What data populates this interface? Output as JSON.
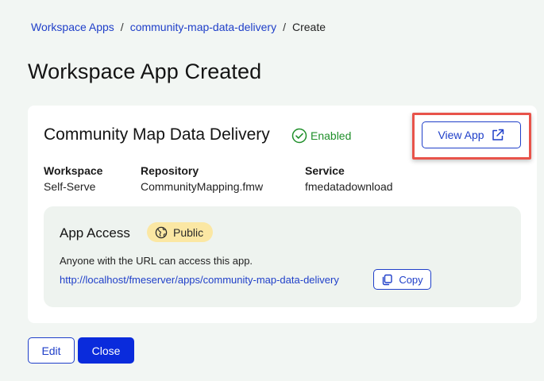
{
  "breadcrumb": {
    "items": [
      "Workspace Apps",
      "community-map-data-delivery",
      "Create"
    ],
    "separator": "/"
  },
  "page_title": "Workspace App Created",
  "app": {
    "name": "Community Map Data Delivery",
    "status": "Enabled",
    "view_label": "View App",
    "meta": [
      {
        "label": "Workspace",
        "value": "Self-Serve"
      },
      {
        "label": "Repository",
        "value": "CommunityMapping.fmw"
      },
      {
        "label": "Service",
        "value": "fmedatadownload"
      }
    ]
  },
  "access": {
    "title": "App Access",
    "badge": "Public",
    "description": "Anyone with the URL can access this app.",
    "url": "http://localhost/fmeserver/apps/community-map-data-delivery",
    "copy_label": "Copy"
  },
  "actions": {
    "edit_label": "Edit",
    "close_label": "Close"
  },
  "colors": {
    "accent": "#1f3fc9",
    "primary_button": "#0a2bdc",
    "enabled": "#1f8f2a",
    "public_badge": "#fbe7a3",
    "highlight": "#e8534a",
    "page_background": "#f2f6f3"
  }
}
